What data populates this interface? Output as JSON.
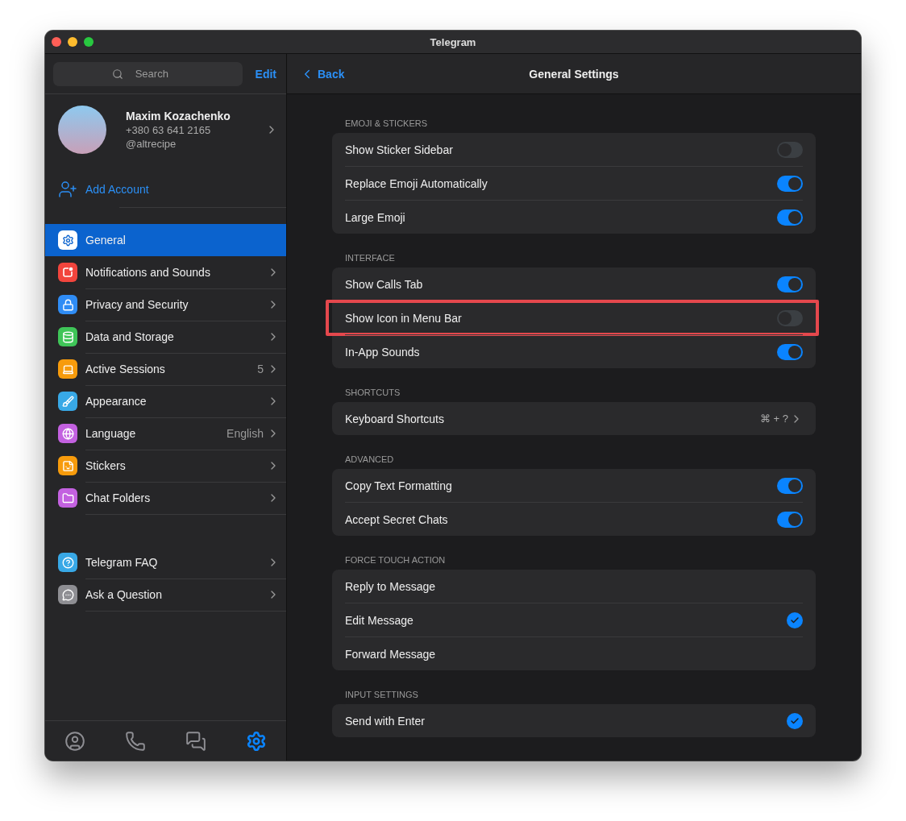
{
  "window": {
    "title": "Telegram"
  },
  "sidebar": {
    "search": {
      "placeholder": "Search"
    },
    "edit": "Edit",
    "profile": {
      "name": "Maxim Kozachenko",
      "phone": "+380 63 641 2165",
      "username": "@altrecipe"
    },
    "add_account": "Add Account",
    "items": [
      {
        "label": "General",
        "color": "#ffffff",
        "selected": true
      },
      {
        "label": "Notifications and Sounds",
        "color": "#f2453d",
        "selected": false
      },
      {
        "label": "Privacy and Security",
        "color": "#2f8cf5",
        "selected": false
      },
      {
        "label": "Data and Storage",
        "color": "#3fc558",
        "selected": false
      },
      {
        "label": "Active Sessions",
        "value": "5",
        "color": "#f79b0c",
        "selected": false
      },
      {
        "label": "Appearance",
        "color": "#38a8e6",
        "selected": false
      },
      {
        "label": "Language",
        "value": "English",
        "color": "#c361e0",
        "selected": false
      },
      {
        "label": "Stickers",
        "color": "#f79b0c",
        "selected": false
      },
      {
        "label": "Chat Folders",
        "color": "#c361e0",
        "selected": false
      }
    ],
    "help_items": [
      {
        "label": "Telegram FAQ",
        "color": "#38a8e6",
        "selected": false
      },
      {
        "label": "Ask a Question",
        "color": "#8e8e93",
        "selected": false
      }
    ],
    "tabs": [
      {
        "selected": false
      },
      {
        "selected": false
      },
      {
        "selected": false
      },
      {
        "selected": true
      }
    ]
  },
  "header": {
    "back": "Back",
    "title": "General Settings"
  },
  "sections": [
    {
      "title": "EMOJI & STICKERS",
      "items": [
        {
          "kind": "toggle",
          "label": "Show Sticker Sidebar",
          "on": false
        },
        {
          "kind": "toggle",
          "label": "Replace Emoji Automatically",
          "on": true
        },
        {
          "kind": "toggle",
          "label": "Large Emoji",
          "on": true
        }
      ]
    },
    {
      "title": "INTERFACE",
      "items": [
        {
          "kind": "toggle",
          "label": "Show Calls Tab",
          "on": true
        },
        {
          "kind": "toggle",
          "label": "Show Icon in Menu Bar",
          "on": false,
          "highlighted": true
        },
        {
          "kind": "toggle",
          "label": "In-App Sounds",
          "on": true
        }
      ]
    },
    {
      "title": "SHORTCUTS",
      "items": [
        {
          "kind": "link",
          "label": "Keyboard Shortcuts",
          "value": "⌘ + ?"
        }
      ]
    },
    {
      "title": "ADVANCED",
      "items": [
        {
          "kind": "toggle",
          "label": "Copy Text Formatting",
          "on": true
        },
        {
          "kind": "toggle",
          "label": "Accept Secret Chats",
          "on": true
        }
      ]
    },
    {
      "title": "FORCE TOUCH ACTION",
      "items": [
        {
          "kind": "radio",
          "label": "Reply to Message",
          "selected": false
        },
        {
          "kind": "radio",
          "label": "Edit Message",
          "selected": true
        },
        {
          "kind": "radio",
          "label": "Forward Message",
          "selected": false
        }
      ]
    },
    {
      "title": "INPUT SETTINGS",
      "items": [
        {
          "kind": "radio",
          "label": "Send with Enter",
          "selected": true
        }
      ]
    }
  ]
}
